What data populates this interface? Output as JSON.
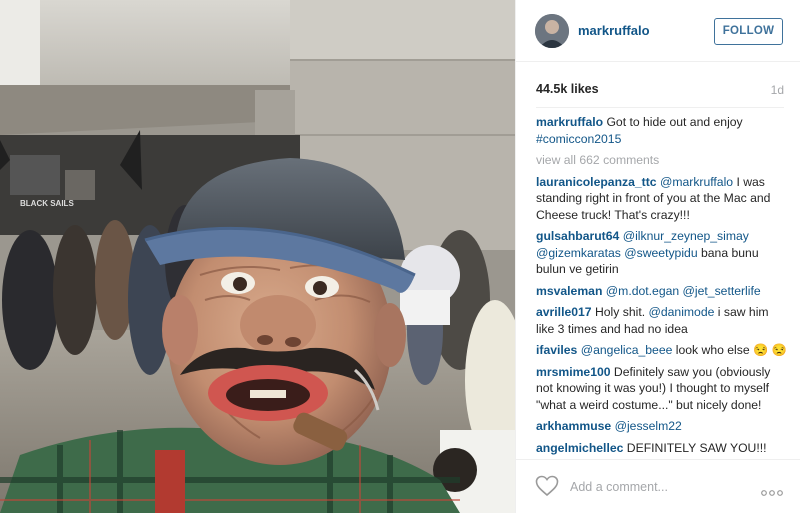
{
  "post": {
    "username": "markruffalo",
    "follow_label": "FOLLOW",
    "likes": "44.5k likes",
    "time_ago": "1d",
    "caption": {
      "user": "markruffalo",
      "text": "Got to hide out and enjoy",
      "hashtag": "#comiccon2015"
    },
    "view_all": "view all 662 comments"
  },
  "comments": [
    {
      "user": "lauranicolepanza_ttc",
      "mentions": [
        "@markruffalo"
      ],
      "text": "I was standing right in front of you at the Mac and Cheese truck! That's crazy!!!"
    },
    {
      "user": "gulsahbarut64",
      "mentions": [
        "@ilknur_zeynep_simay",
        "@gizemkaratas",
        "@sweetypidu"
      ],
      "text": "bana bunu bulun ve getirin"
    },
    {
      "user": "msvaleman",
      "mentions": [
        "@m.dot.egan",
        "@jet_setterlife"
      ],
      "text": ""
    },
    {
      "user": "avrille017",
      "pre_text": "Holy shit.",
      "mentions": [
        "@danimode"
      ],
      "text": "i saw him like 3 times and had no idea"
    },
    {
      "user": "ifaviles",
      "mentions": [
        "@angelica_beee"
      ],
      "text": "look who else 😒 😒"
    },
    {
      "user": "mrsmime100",
      "mentions": [],
      "text": "Definitely saw you (obviously not knowing it was you!) I thought to myself \"what a weird costume...\" but nicely done!"
    },
    {
      "user": "arkhammuse",
      "mentions": [
        "@jesselm22"
      ],
      "text": ""
    },
    {
      "user": "angelmichellec",
      "mentions": [],
      "text": "DEFINITELY SAW YOU!!!"
    }
  ],
  "footer": {
    "add_comment_placeholder": "Add a comment...",
    "heart_icon": "heart-outline-icon",
    "more_icon": "more-options-icon"
  },
  "photo_sign_text": "BLACK SAILS",
  "colors": {
    "link_blue": "#125688",
    "follow_blue": "#3f729b",
    "muted_gray": "#a5a7aa",
    "border": "#efefef"
  }
}
